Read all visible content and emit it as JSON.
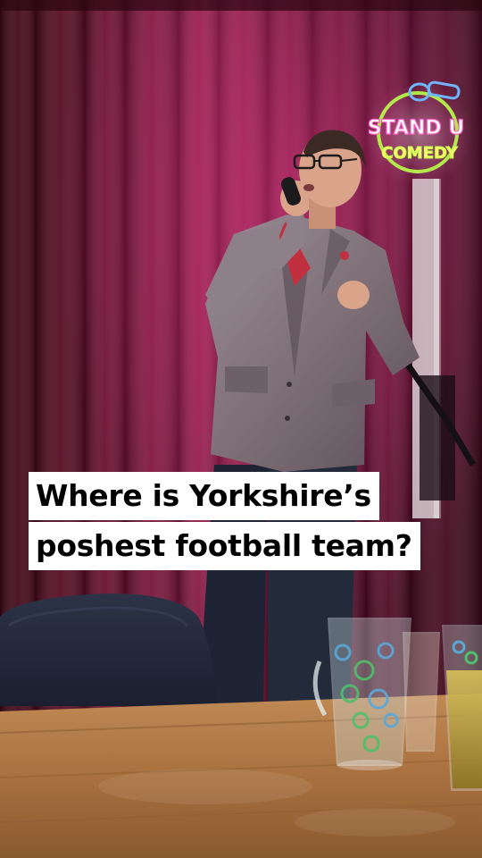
{
  "neon_sign": {
    "line1": "STAND U",
    "line2": "COMEDY"
  },
  "caption": {
    "line1": "Where is Yorkshire’s",
    "line2": "poshest football team?"
  },
  "colors": {
    "curtain": "#6a1230",
    "neon_pink": "#ff5fc8",
    "neon_blue": "#6fb6ff",
    "neon_green": "#b8ff4a",
    "table": "#b07a45",
    "caption_bg": "#ffffff",
    "caption_text": "#000000"
  }
}
